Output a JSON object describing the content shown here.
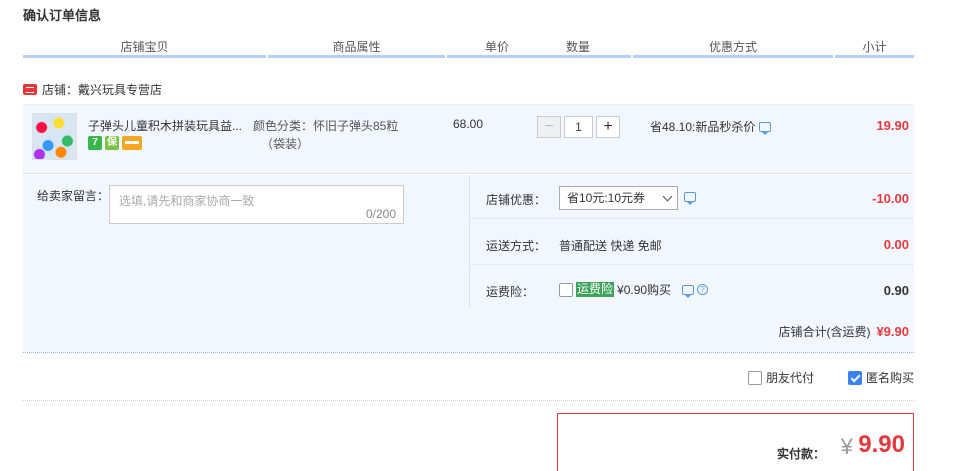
{
  "page_title": "确认订单信息",
  "columns": [
    "店铺宝贝",
    "商品属性",
    "单价",
    "数量",
    "优惠方式",
    "小计"
  ],
  "shop": {
    "name": "店铺：戴兴玩具专营店"
  },
  "item": {
    "title": "子弹头儿童积木拼装玩具益...",
    "badges": [
      "7",
      "保"
    ],
    "attr_line1": "颜色分类：怀旧子弹头85粒",
    "attr_line2": "（袋装）",
    "unit_price": "68.00",
    "quantity": "1",
    "minus": "−",
    "plus": "+",
    "promo": "省48.10:新品秒杀价",
    "subtotal": "19.90"
  },
  "memo": {
    "label": "给卖家留言：",
    "placeholder": "选填,请先和商家协商一致",
    "counter": "0/200"
  },
  "shop_discount": {
    "label": "店铺优惠：",
    "selected": "省10元:10元券",
    "amount": "-10.00"
  },
  "shipping": {
    "label": "运送方式：",
    "value": "普通配送 快递 免邮",
    "amount": "0.00"
  },
  "insurance": {
    "label": "运费险：",
    "tag": "运费险",
    "text": "¥0.90购买",
    "amount": "0.90"
  },
  "shop_total": {
    "label": "店铺合计(含运费)",
    "value": "¥9.90"
  },
  "extras": {
    "friend_pay": "朋友代付",
    "anonymous": "匿名购买"
  },
  "payment": {
    "label": "实付款：",
    "currency": "¥",
    "amount": "9.90"
  }
}
